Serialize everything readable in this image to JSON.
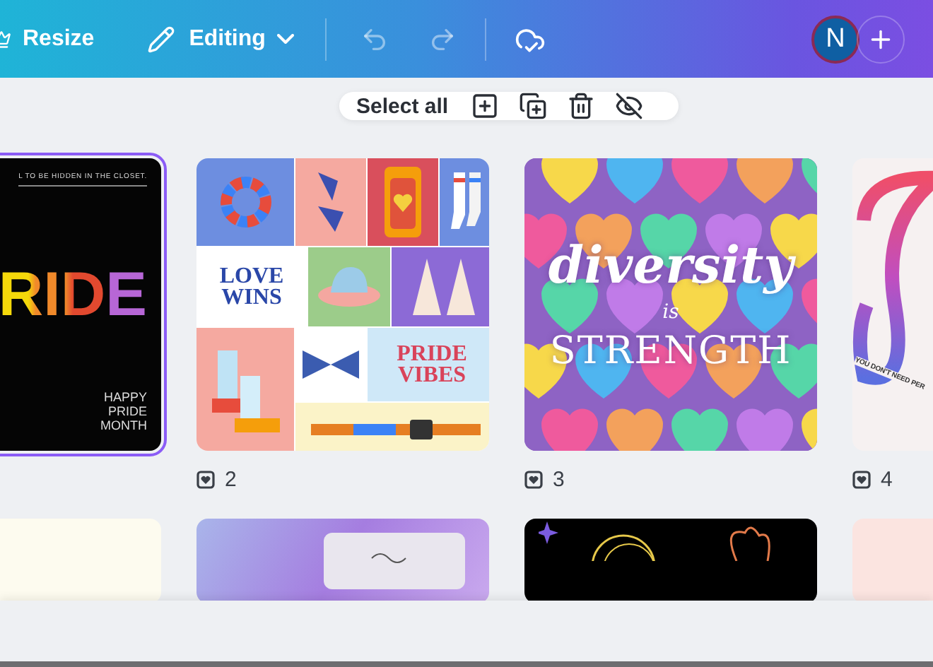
{
  "topbar": {
    "resize_label": "Resize",
    "mode_label": "Editing",
    "history": [
      {
        "kind": "undo",
        "disabled": true
      },
      {
        "kind": "redo",
        "disabled": true
      }
    ],
    "avatar": "N"
  },
  "selection_toolbar": {
    "label": "Select all"
  },
  "designs": [
    {
      "kind": "pride-poster",
      "selected": true,
      "top_line": "L TO BE HIDDEN IN THE CLOSET.",
      "headline": "RIDE",
      "footer": "HAPPY\nPRIDE\nMONTH"
    },
    {
      "kind": "collage",
      "selected": false,
      "page_count": "2",
      "texts": [
        "LOVE\nWINS",
        "PRIDE\nVIBES"
      ]
    },
    {
      "kind": "hearts",
      "selected": false,
      "page_count": "3",
      "texts": [
        "diversity",
        "is",
        "STRENGTH"
      ]
    },
    {
      "kind": "infinity",
      "selected": false,
      "page_count": "4",
      "texts": [
        "YOU DON'T NEED PER"
      ]
    }
  ],
  "more_designs": [
    {
      "kind": "cream"
    },
    {
      "kind": "lilac"
    },
    {
      "kind": "night"
    },
    {
      "kind": "blush"
    }
  ]
}
